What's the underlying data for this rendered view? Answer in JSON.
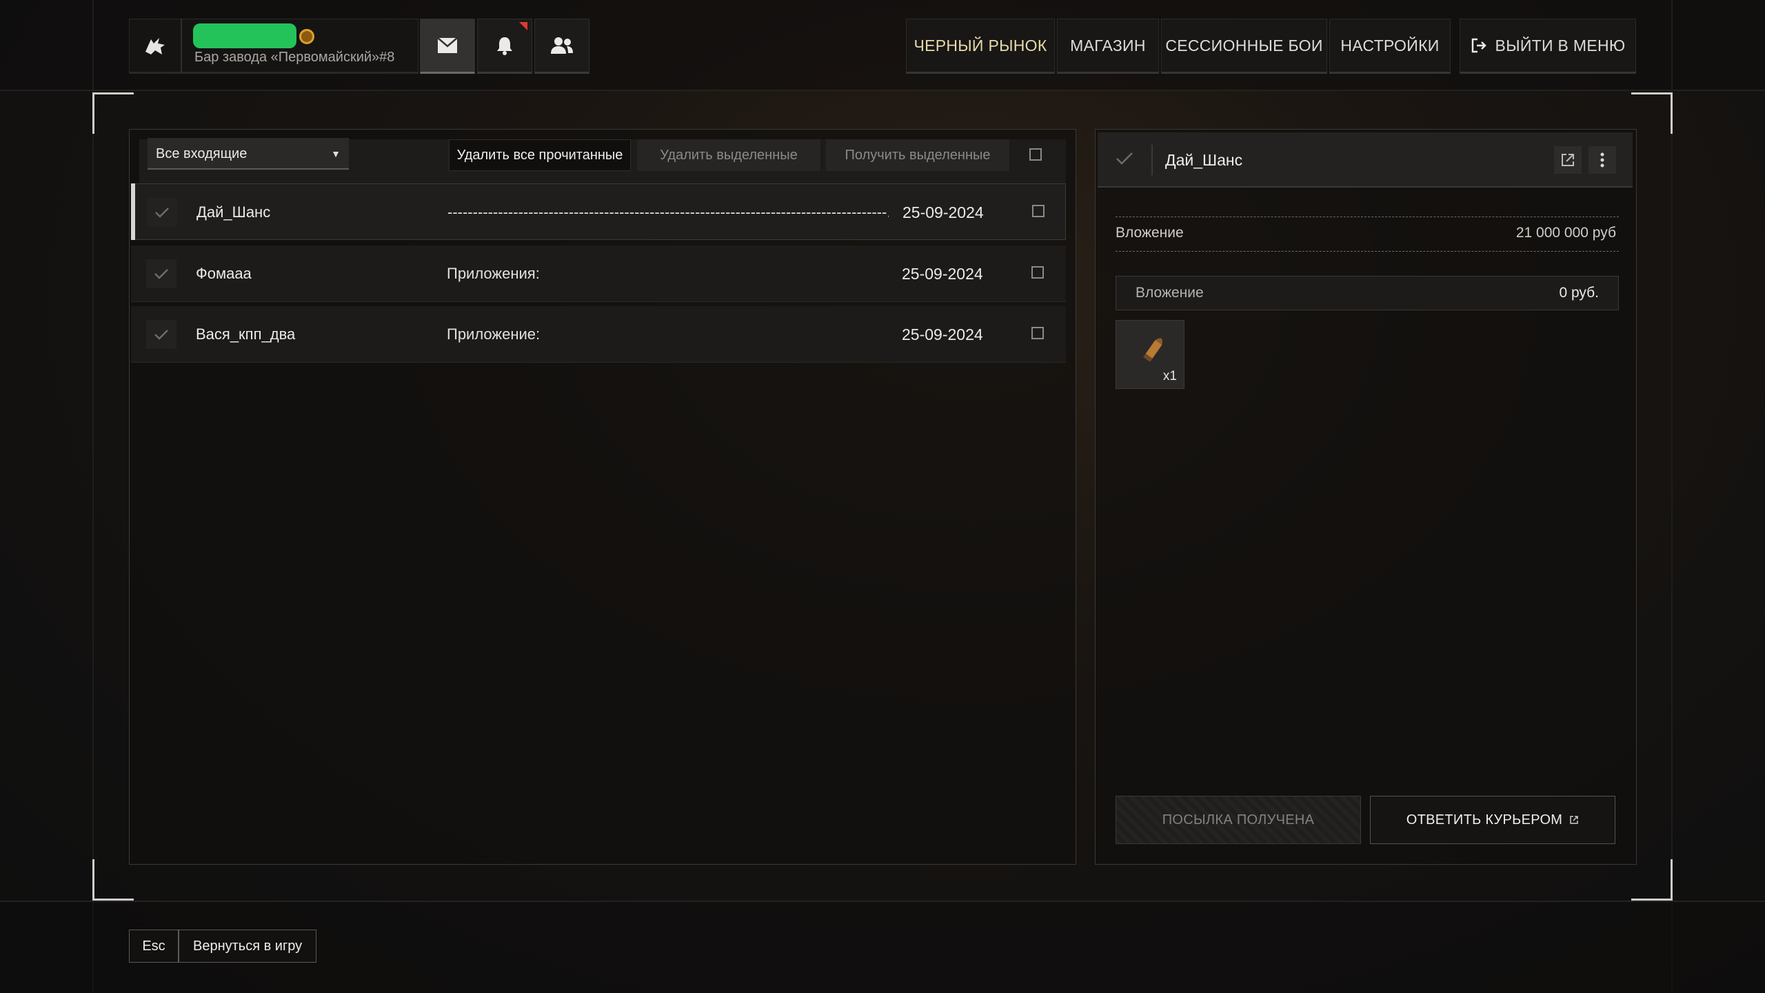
{
  "profile": {
    "server": "Бар завода «Первомайский»#8"
  },
  "nav": {
    "black_market": "ЧЕРНЫЙ РЫНОК",
    "shop": "МАГАЗИН",
    "session_battles": "СЕССИОННЫЕ БОИ",
    "settings": "НАСТРОЙКИ",
    "exit": "ВЫЙТИ В МЕНЮ"
  },
  "mail": {
    "filter_selected": "Все входящие",
    "delete_read": "Удалить все прочитанные",
    "delete_selected": "Удалить выделенные",
    "receive_selected": "Получить выделенные",
    "messages": [
      {
        "sender": "Дай_Шанс",
        "subject": "---------------------------------------------------------------------------------------..",
        "date": "25-09-2024"
      },
      {
        "sender": "Фомааа",
        "subject": "Приложения:",
        "date": "25-09-2024"
      },
      {
        "sender": "Вася_кпп_два",
        "subject": "Приложение:",
        "date": "25-09-2024"
      }
    ]
  },
  "detail": {
    "title": "Дай_Шанс",
    "investment_label": "Вложение",
    "investment_value": "21 000 000 руб",
    "cod_label": "Вложение",
    "cod_value": "0 руб.",
    "item_qty": "x1",
    "package_received": "ПОСЫЛКА ПОЛУЧЕНА",
    "reply_courier": "ОТВЕТИТЬ КУРЬЕРОМ"
  },
  "footer": {
    "key": "Esc",
    "label": "Вернуться в игру"
  },
  "colors": {
    "accent_gold": "#e8d9a6",
    "notification": "#e03a2f",
    "status_green": "#23c35a"
  }
}
